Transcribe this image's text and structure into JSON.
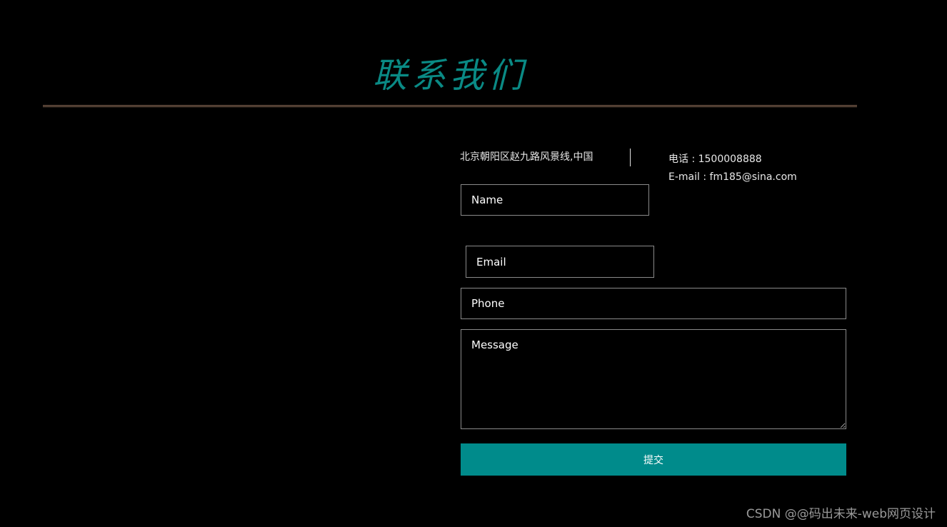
{
  "header": {
    "title": "联系我们"
  },
  "info": {
    "address": "北京朝阳区赵九路风景线,中国",
    "phone": "电话 : 1500008888",
    "email": "E-mail : fm185@sina.com"
  },
  "form": {
    "name_placeholder": "Name",
    "email_placeholder": "Email",
    "phone_placeholder": "Phone",
    "message_placeholder": "Message",
    "submit_label": "提交"
  },
  "watermark": "CSDN @@码出未来-web网页设计",
  "colors": {
    "title": "#0a8a85",
    "submit_bg": "#008b8b",
    "background": "#000000",
    "rule": "#8a6a56"
  }
}
